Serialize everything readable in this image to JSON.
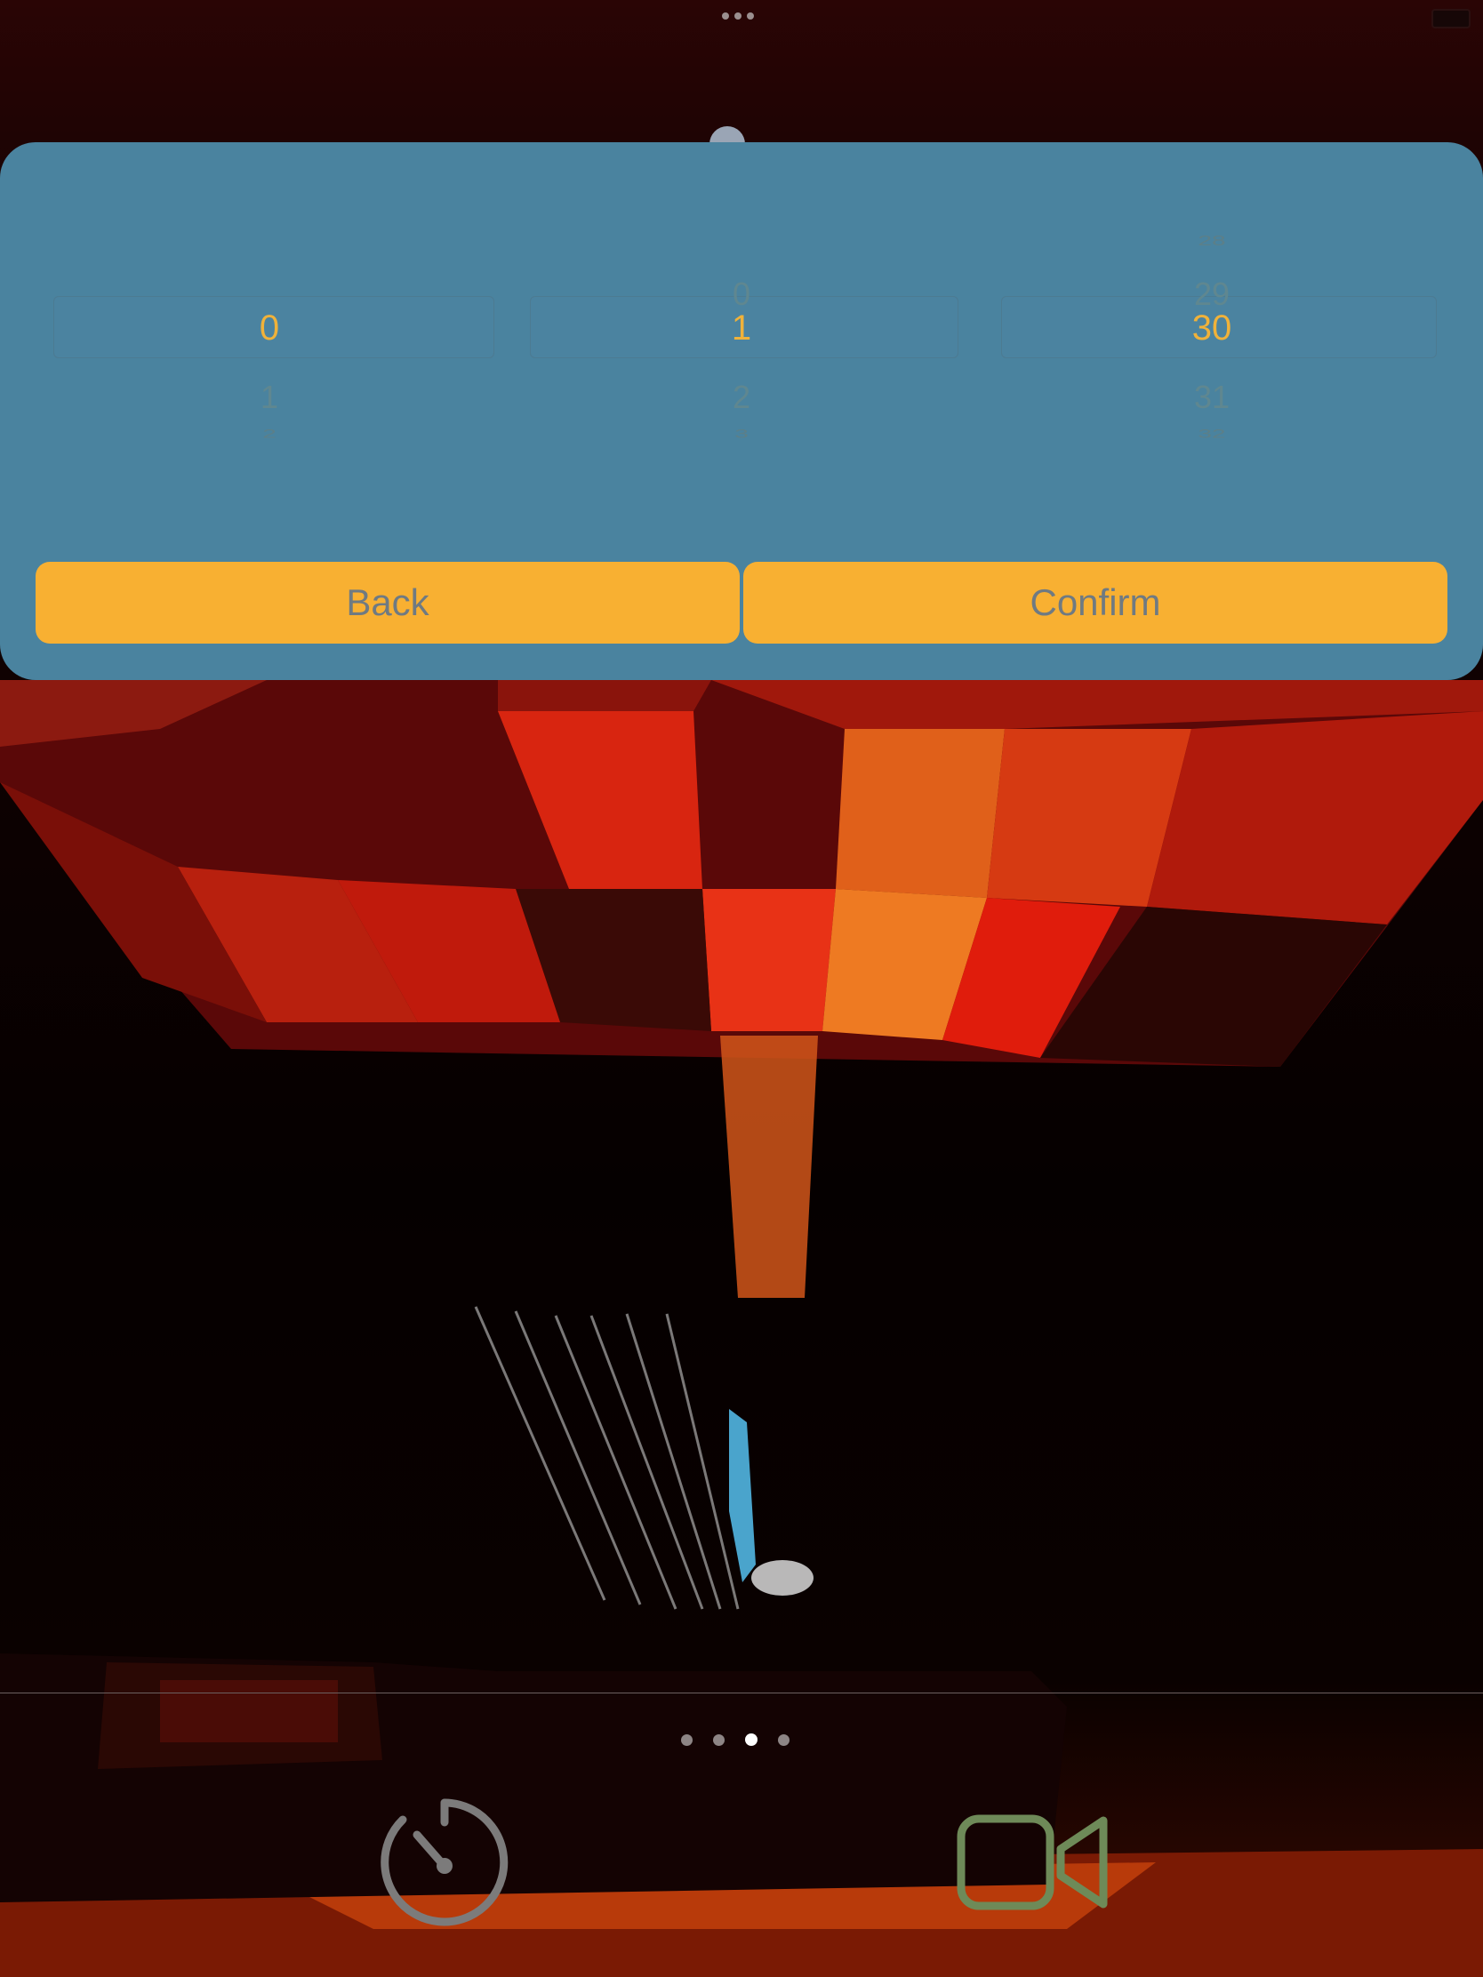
{
  "picker": {
    "columns": [
      {
        "above2": "",
        "above1": "",
        "selected": "0",
        "below1": "1",
        "below2": "2"
      },
      {
        "above2": "",
        "above1": "0",
        "selected": "1",
        "below1": "2",
        "below2": "3"
      },
      {
        "above2": "28",
        "above1": "29",
        "selected": "30",
        "below1": "31",
        "below2": "32"
      }
    ]
  },
  "buttons": {
    "back": "Back",
    "confirm": "Confirm"
  },
  "pager": {
    "count": 4,
    "active_index": 2
  },
  "toolbar": {
    "left_icon": "timer-icon",
    "right_icon": "video-camera-icon"
  },
  "colors": {
    "sheet": "#4a839f",
    "button": "#f8b032",
    "button_text": "#6f7a82",
    "selected_number": "#f0b23a",
    "timer_icon": "#7c7b7b",
    "video_icon": "#6e8a58"
  }
}
